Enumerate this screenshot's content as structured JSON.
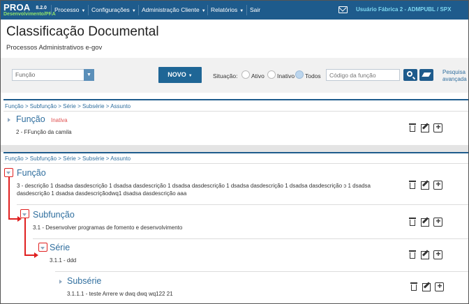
{
  "app": {
    "name": "PROA",
    "version": "8.2.0",
    "environment": "Desenvolvimento/PRA",
    "user": "Usuário Fábrica 2 - ADMPUBL / SPX"
  },
  "nav": {
    "items": [
      "Processo",
      "Configurações",
      "Administração Cliente",
      "Relatórios",
      "Sair"
    ]
  },
  "page": {
    "title": "Classificação Documental",
    "subtitle": "Processos Administrativos e-gov"
  },
  "filters": {
    "select_value": "Função",
    "novo_label": "NOVO",
    "situacao_label": "Situação:",
    "options": [
      "Ativo",
      "Inativo",
      "Todos"
    ],
    "selected_option": "Todos",
    "codigo_placeholder": "Código da função",
    "advanced_search_line1": "Pesquisa",
    "advanced_search_line2": "avançada"
  },
  "results": [
    {
      "breadcrumb": "Função > Subfunção > Série > Subsérie > Assunto",
      "title": "Função",
      "status": "Inativa",
      "description": "2 - FFunção da camila"
    },
    {
      "breadcrumb": "Função > Subfunção > Série > Subsérie > Assunto",
      "levels": [
        {
          "title": "Função",
          "description_line1": "3 - descrição 1 dsadsa dasdescrição 1 dsadsa dasdescrição 1 dsadsa dasdescrição 1 dsadsa dasdescrição 1 dsadsa dasdescrição ɔ 1 dsadsa",
          "description_line2": "dasdescrição 1 dsadsa dasdescriçãodwq1 dsadsa dasdescrição aaa"
        },
        {
          "title": "Subfunção",
          "description": "3.1 - Desenvolver programas de fomento e desenvolvimento"
        },
        {
          "title": "Série",
          "description": "3.1.1 - ddd"
        },
        {
          "title": "Subsérie",
          "description": "3.1.1.1 - teste Arrere w dwq dwq wq122 21"
        }
      ]
    }
  ],
  "colors": {
    "navbar": "#1e5b8c",
    "accent_link": "#2f6e9e",
    "inactive": "#e05050",
    "environment": "#8fe36a",
    "user_info": "#7ed8f0",
    "annotation": "#e02020"
  },
  "icons": [
    "mail-icon",
    "search-icon",
    "eraser-icon",
    "trash-icon",
    "edit-icon",
    "plus-icon",
    "expand-arrow-icon",
    "collapse-arrow-icon"
  ]
}
